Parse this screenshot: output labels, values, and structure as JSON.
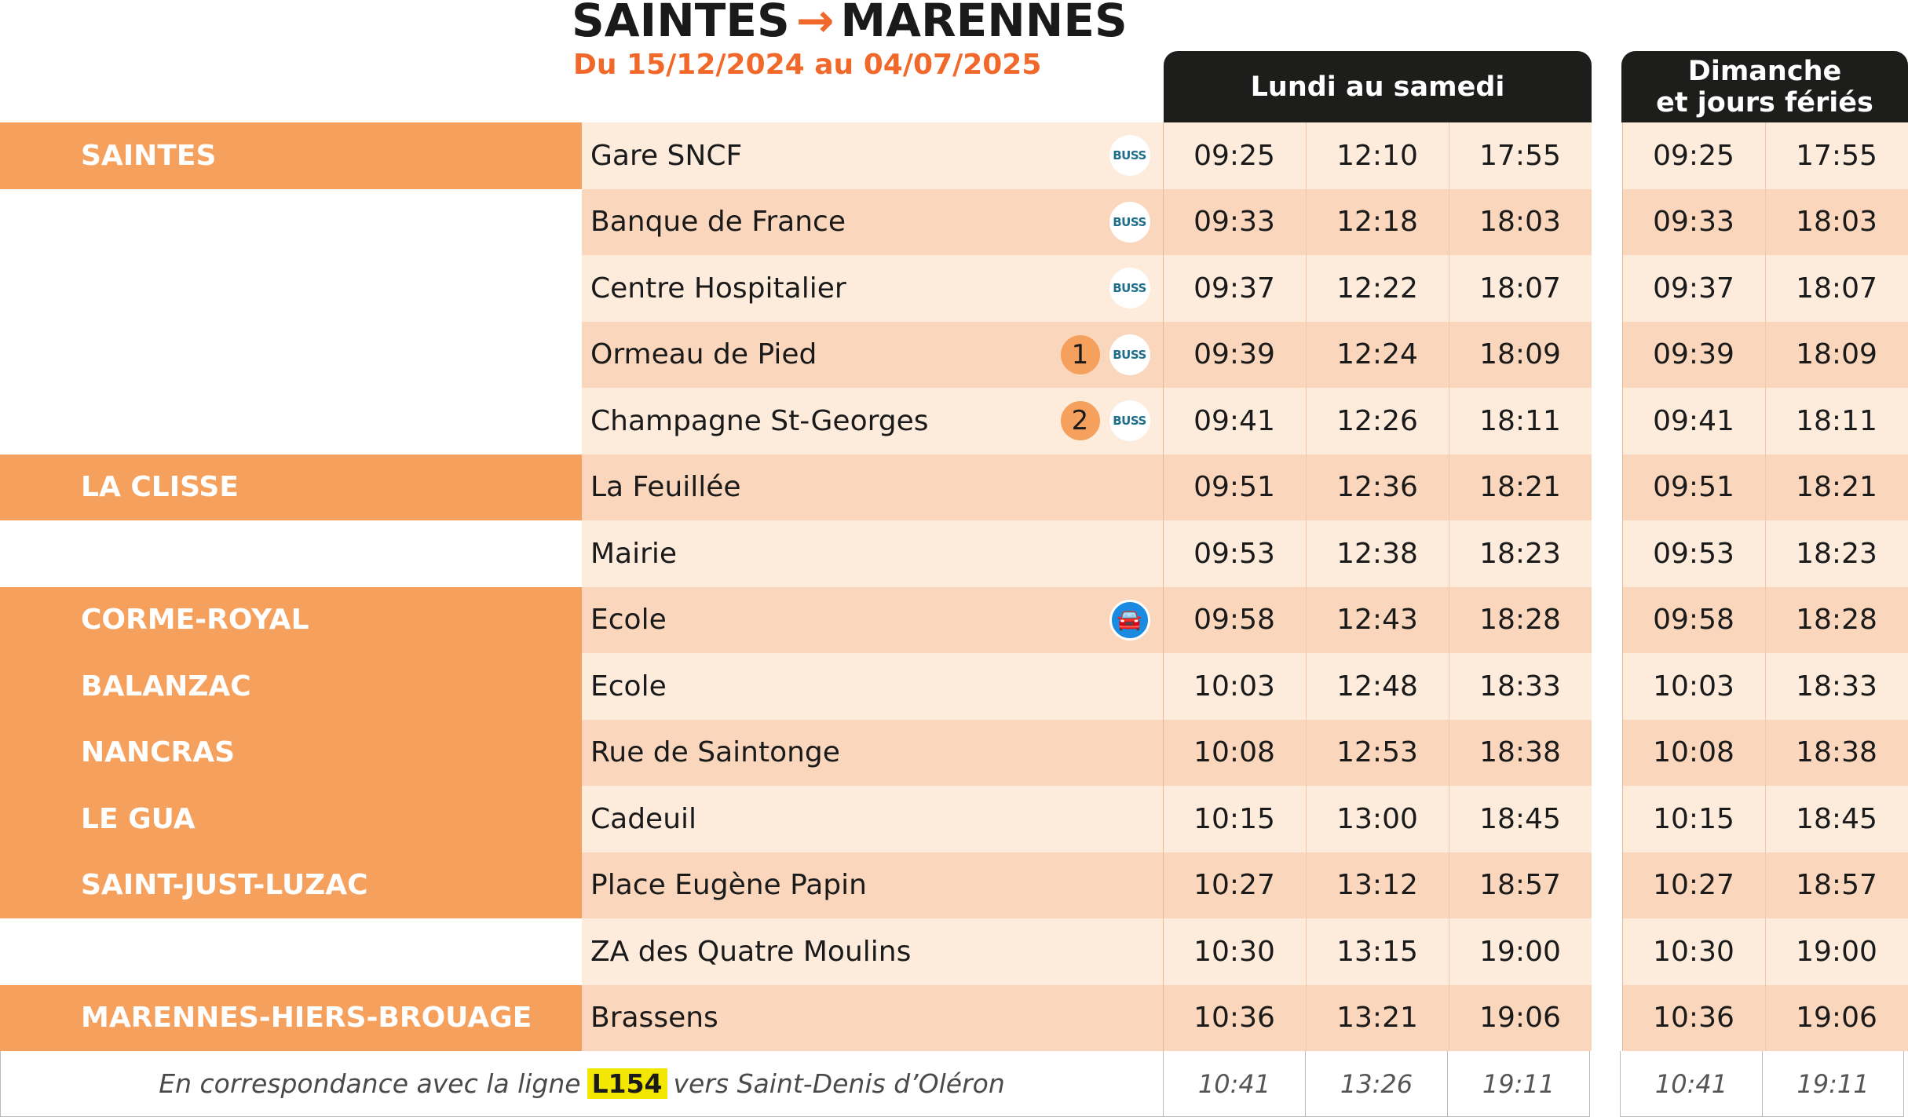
{
  "title": {
    "from": "SAINTES",
    "arrow": "→",
    "to": "MARENNES"
  },
  "subtitle": "Du 15/12/2024 au 04/07/2025",
  "headers": {
    "week": "Lundi au samedi",
    "sunday_line1": "Dimanche",
    "sunday_line2": "et jours fériés"
  },
  "rows": [
    {
      "town": "SAINTES",
      "stop": "Gare SNCF",
      "num": "",
      "icon": "buss",
      "week": [
        "09:25",
        "12:10",
        "17:55"
      ],
      "sun": [
        "09:25",
        "17:55"
      ]
    },
    {
      "town": "",
      "stop": "Banque de France",
      "num": "",
      "icon": "buss",
      "week": [
        "09:33",
        "12:18",
        "18:03"
      ],
      "sun": [
        "09:33",
        "18:03"
      ]
    },
    {
      "town": "",
      "stop": "Centre Hospitalier",
      "num": "",
      "icon": "buss",
      "week": [
        "09:37",
        "12:22",
        "18:07"
      ],
      "sun": [
        "09:37",
        "18:07"
      ]
    },
    {
      "town": "",
      "stop": "Ormeau de Pied",
      "num": "1",
      "icon": "buss",
      "week": [
        "09:39",
        "12:24",
        "18:09"
      ],
      "sun": [
        "09:39",
        "18:09"
      ]
    },
    {
      "town": "",
      "stop": "Champagne St-Georges",
      "num": "2",
      "icon": "buss",
      "week": [
        "09:41",
        "12:26",
        "18:11"
      ],
      "sun": [
        "09:41",
        "18:11"
      ]
    },
    {
      "town": "LA CLISSE",
      "stop": "La Feuillée",
      "num": "",
      "icon": "",
      "week": [
        "09:51",
        "12:36",
        "18:21"
      ],
      "sun": [
        "09:51",
        "18:21"
      ]
    },
    {
      "town": "",
      "stop": "Mairie",
      "num": "",
      "icon": "",
      "week": [
        "09:53",
        "12:38",
        "18:23"
      ],
      "sun": [
        "09:53",
        "18:23"
      ]
    },
    {
      "town": "CORME-ROYAL",
      "stop": "Ecole",
      "num": "",
      "icon": "carpool",
      "week": [
        "09:58",
        "12:43",
        "18:28"
      ],
      "sun": [
        "09:58",
        "18:28"
      ]
    },
    {
      "town": "BALANZAC",
      "stop": "Ecole",
      "num": "",
      "icon": "",
      "week": [
        "10:03",
        "12:48",
        "18:33"
      ],
      "sun": [
        "10:03",
        "18:33"
      ]
    },
    {
      "town": "NANCRAS",
      "stop": "Rue de Saintonge",
      "num": "",
      "icon": "",
      "week": [
        "10:08",
        "12:53",
        "18:38"
      ],
      "sun": [
        "10:08",
        "18:38"
      ]
    },
    {
      "town": "LE GUA",
      "stop": "Cadeuil",
      "num": "",
      "icon": "",
      "week": [
        "10:15",
        "13:00",
        "18:45"
      ],
      "sun": [
        "10:15",
        "18:45"
      ]
    },
    {
      "town": "SAINT-JUST-LUZAC",
      "stop": "Place Eugène Papin",
      "num": "",
      "icon": "",
      "week": [
        "10:27",
        "13:12",
        "18:57"
      ],
      "sun": [
        "10:27",
        "18:57"
      ]
    },
    {
      "town": "",
      "stop": "ZA des Quatre Moulins",
      "num": "",
      "icon": "",
      "week": [
        "10:30",
        "13:15",
        "19:00"
      ],
      "sun": [
        "10:30",
        "19:00"
      ]
    },
    {
      "town": "MARENNES-HIERS-BROUAGE",
      "stop": "Brassens",
      "num": "",
      "icon": "",
      "week": [
        "10:36",
        "13:21",
        "19:06"
      ],
      "sun": [
        "10:36",
        "19:06"
      ]
    }
  ],
  "town_band_on": [
    true,
    false,
    false,
    false,
    false,
    true,
    false,
    true,
    true,
    true,
    true,
    true,
    false,
    true
  ],
  "footer": {
    "before": "En correspondance avec la ligne",
    "line": "L154",
    "after": "vers Saint-Denis d’Oléron",
    "week": [
      "10:41",
      "13:26",
      "19:11"
    ],
    "sun": [
      "10:41",
      "19:11"
    ]
  },
  "colors": {
    "accent_orange": "#f0692b",
    "band_orange": "#f6a05d",
    "row_light": "#fdebdc",
    "row_dark": "#fad6bc",
    "header_dark": "#1d1d1b",
    "line_tag": "#f3e600"
  },
  "icons": {
    "buss": "buss-logo-icon",
    "carpool": "carpool-icon"
  },
  "buss_label": "BUSS"
}
